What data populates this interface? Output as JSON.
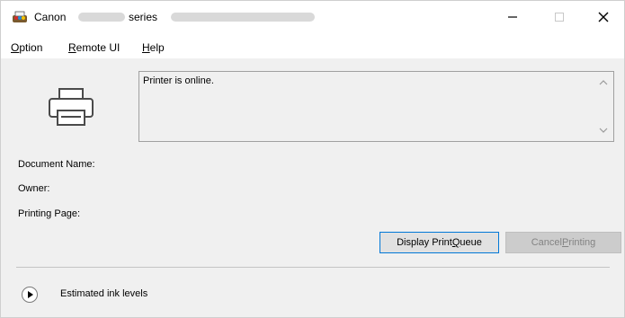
{
  "window": {
    "title_brand": "Canon",
    "title_series": "series",
    "minimize_glyph": "—",
    "maximize_glyph": "☐",
    "close_glyph": "✕"
  },
  "menu": {
    "items": [
      {
        "key": "O",
        "rest": "ption"
      },
      {
        "key": "R",
        "rest": "emote UI"
      },
      {
        "key": "H",
        "rest": "elp"
      }
    ]
  },
  "status": {
    "message": "Printer is online."
  },
  "fields": {
    "document_name_label": "Document Name:",
    "owner_label": "Owner:",
    "printing_page_label": "Printing Page:"
  },
  "buttons": {
    "display_queue_pre": "Display Print ",
    "display_queue_key": "Q",
    "display_queue_post": "ueue",
    "cancel_pre": "Cancel ",
    "cancel_key": "P",
    "cancel_post": "rinting"
  },
  "ink": {
    "label": "Estimated ink levels"
  },
  "icons": {
    "app": "canon-printer-app-icon",
    "printer": "printer-icon",
    "expand": "play-icon"
  },
  "colors": {
    "focus_border": "#0078d7",
    "disabled_text": "#838383"
  }
}
